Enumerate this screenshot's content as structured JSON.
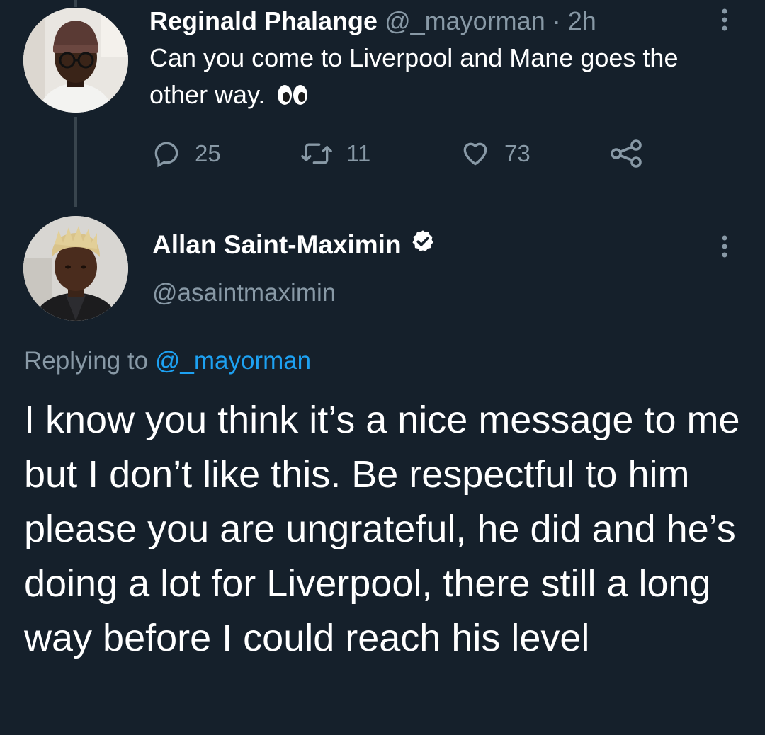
{
  "tweet1": {
    "name": "Reginald Phalange",
    "handle": "@_mayorman",
    "separator": " · ",
    "time": "2h",
    "text": "Can you come to Liverpool and Mane goes the other way.",
    "emoji": "eyes-emoji",
    "replies": "25",
    "retweets": "11",
    "likes": "73"
  },
  "tweet2": {
    "name": "Allan Saint-Maximin",
    "handle": "@asaintmaximin",
    "replying_prefix": "Replying to ",
    "replying_to": "@_mayorman",
    "text": "I know you think it’s a nice message to me but I don’t like this. Be respectful to him please you are ungrateful, he did and he’s doing a lot for Liverpool, there still a long way before I could reach his level"
  },
  "colors": {
    "background": "#15202b",
    "secondary_text": "#8899a6",
    "accent": "#1da1f2",
    "thread_line": "#38444d"
  },
  "icons": [
    "more-icon",
    "reply-icon",
    "retweet-icon",
    "like-icon",
    "share-icon",
    "verified-badge-icon"
  ]
}
